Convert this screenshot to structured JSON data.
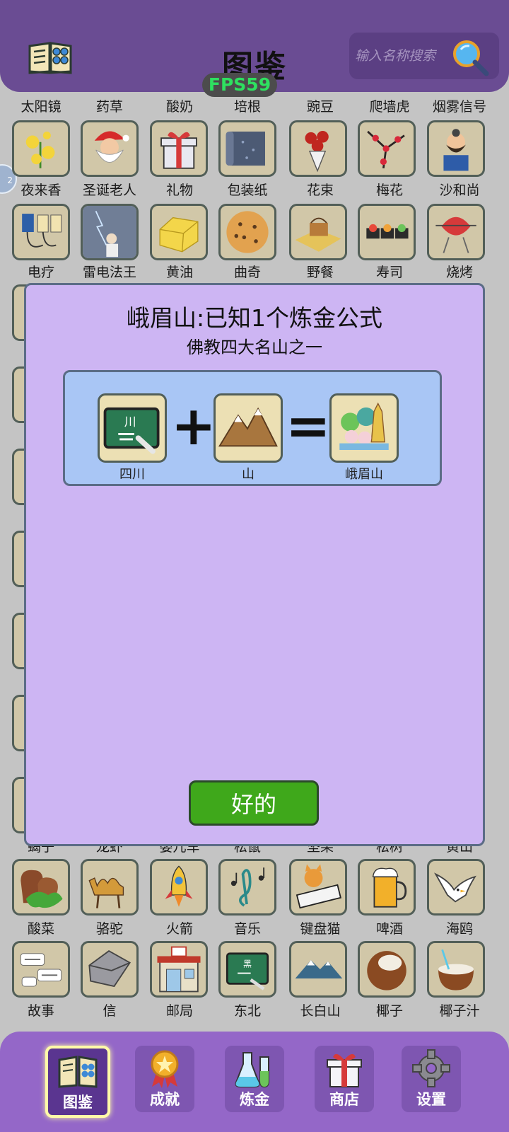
{
  "header": {
    "title": "图鉴",
    "search_placeholder": "输入名称搜索",
    "fps": "FPS59",
    "side_badge": "2"
  },
  "grid": {
    "rows": [
      {
        "labels": [
          "太阳镜",
          "药草",
          "酸奶",
          "培根",
          "豌豆",
          "爬墙虎",
          "烟雾信号"
        ]
      },
      {
        "icons": [
          "evening-primrose-icon",
          "santa-claus-icon",
          "gift-icon",
          "wrapping-paper-icon",
          "flower-bouquet-icon",
          "plum-blossom-icon",
          "sha-heshang-icon"
        ],
        "labels": [
          "夜来香",
          "圣诞老人",
          "礼物",
          "包装纸",
          "花束",
          "梅花",
          "沙和尚"
        ]
      },
      {
        "icons": [
          "electrotherapy-icon",
          "thunder-wizard-icon",
          "butter-icon",
          "cookie-icon",
          "picnic-icon",
          "sushi-icon",
          "barbecue-icon"
        ],
        "labels": [
          "电疗",
          "雷电法王",
          "黄油",
          "曲奇",
          "野餐",
          "寿司",
          "烧烤"
        ]
      },
      {
        "labels": [
          "蝎子",
          "龙虾",
          "婴儿车",
          "松鼠",
          "坚果",
          "松树",
          "黄山"
        ]
      },
      {
        "icons": [
          "pickled-cabbage-icon",
          "camel-icon",
          "rocket-icon",
          "music-icon",
          "keyboard-cat-icon",
          "beer-icon",
          "seagull-icon"
        ],
        "labels": [
          "酸菜",
          "骆驼",
          "火箭",
          "音乐",
          "键盘猫",
          "啤酒",
          "海鸥"
        ]
      },
      {
        "icons": [
          "story-icon",
          "letter-icon",
          "post-office-icon",
          "northeast-icon",
          "changbai-mountain-icon",
          "coconut-icon",
          "coconut-juice-icon"
        ],
        "labels": [
          "故事",
          "信",
          "邮局",
          "东北",
          "长白山",
          "椰子",
          "椰子汁"
        ]
      }
    ]
  },
  "modal": {
    "title": "峨眉山:已知1个炼金公式",
    "subtitle": "佛教四大名山之一",
    "formula": {
      "input1": {
        "label": "四川",
        "board_text": "川"
      },
      "plus": "+",
      "input2": {
        "label": "山"
      },
      "equals": "=",
      "output": {
        "label": "峨眉山"
      }
    },
    "ok_label": "好的"
  },
  "nav": {
    "items": [
      {
        "label": "图鉴",
        "active": true
      },
      {
        "label": "成就",
        "active": false
      },
      {
        "label": "炼金",
        "active": false
      },
      {
        "label": "商店",
        "active": false
      },
      {
        "label": "设置",
        "active": false
      }
    ]
  },
  "colors": {
    "header_bg": "#6a4c93",
    "modal_bg": "#cdb5f3",
    "formula_bg": "#a9c6f5",
    "ok_button": "#3fa81b",
    "navbar_bg": "#9467c8",
    "fps_text": "#2ee060"
  }
}
